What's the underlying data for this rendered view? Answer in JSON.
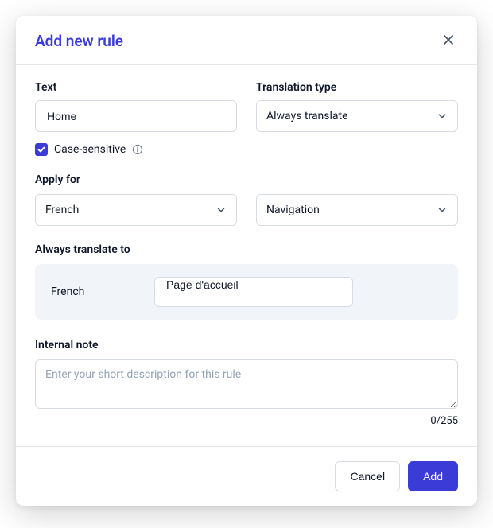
{
  "modal": {
    "title": "Add new rule"
  },
  "text_section": {
    "label": "Text",
    "value": "Home"
  },
  "translation_type": {
    "label": "Translation type",
    "value": "Always translate"
  },
  "case_sensitive": {
    "label": "Case-sensitive",
    "checked": true
  },
  "apply_for": {
    "label": "Apply for",
    "language_value": "French",
    "context_value": "Navigation"
  },
  "always_translate": {
    "label": "Always translate to",
    "language": "French",
    "value": "Page d'accueil"
  },
  "internal_note": {
    "label": "Internal note",
    "placeholder": "Enter your short description for this rule",
    "value": "",
    "char_count": "0/255"
  },
  "footer": {
    "cancel": "Cancel",
    "add": "Add"
  }
}
